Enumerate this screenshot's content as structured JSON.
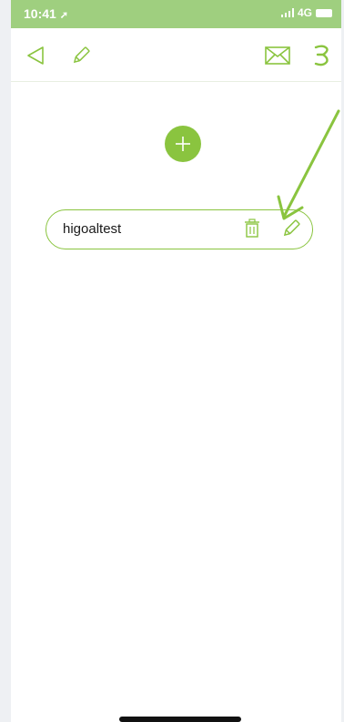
{
  "status_bar": {
    "time": "10:41",
    "network": "4G"
  },
  "header": {
    "back_icon": "back-triangle-icon",
    "edit_icon": "pencil-icon",
    "mail_icon": "mail-icon",
    "menu_icon": "menu-icon"
  },
  "list": {
    "add_icon": "plus-icon",
    "items": [
      {
        "label": "higoaltest",
        "delete_icon": "trash-icon",
        "edit_icon": "pencil-icon"
      }
    ]
  },
  "colors": {
    "accent": "#8ac43f",
    "status_bar": "#9fcf7f",
    "arrow": "#8ac43f"
  }
}
